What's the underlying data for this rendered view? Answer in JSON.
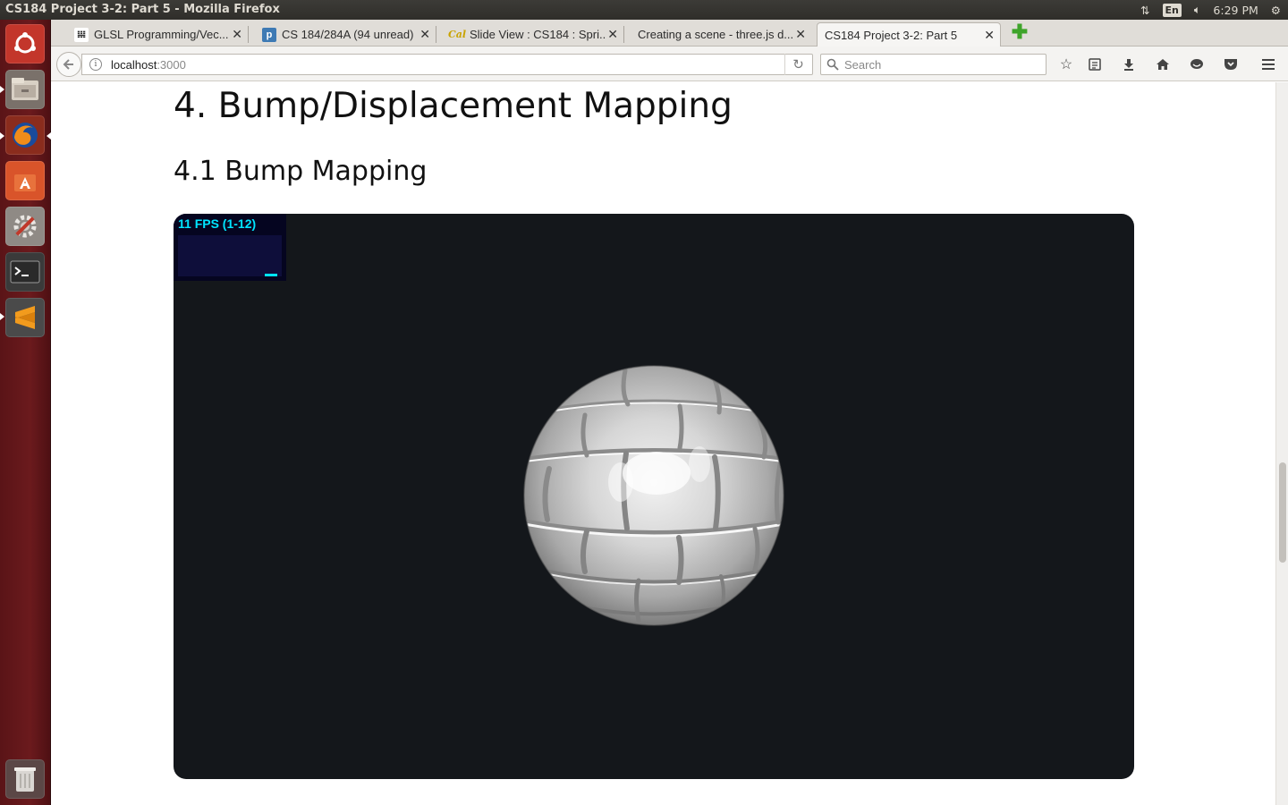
{
  "window": {
    "title": "CS184 Project 3-2: Part 5 - Mozilla Firefox"
  },
  "system_tray": {
    "keyboard_layout": "En",
    "clock": "6:29 PM"
  },
  "launcher": {
    "items": [
      "ubuntu-dash",
      "files",
      "firefox",
      "software-center",
      "system-settings",
      "terminal",
      "sublime-text",
      "trash"
    ]
  },
  "tabs": [
    {
      "title": "GLSL Programming/Vec...",
      "favicon": "wikibooks-icon"
    },
    {
      "title": "CS 184/284A (94 unread)",
      "favicon": "piazza-icon"
    },
    {
      "title": "Slide View : CS184 : Spri...",
      "favicon": "cal-icon"
    },
    {
      "title": "Creating a scene - three.js d...",
      "favicon": ""
    },
    {
      "title": "CS184 Project 3-2: Part 5",
      "favicon": ""
    }
  ],
  "navbar": {
    "url_host": "localhost",
    "url_port": ":3000",
    "search_placeholder": "Search"
  },
  "page": {
    "section_title": "4. Bump/Displacement Mapping",
    "subsection_title": "4.1 Bump Mapping",
    "fps_readout": "11 FPS (1-12)"
  },
  "colors": {
    "canvas_bg": "#14171b",
    "fps_text": "#00e5ff",
    "launcher_bg": "#6b1a1d"
  }
}
